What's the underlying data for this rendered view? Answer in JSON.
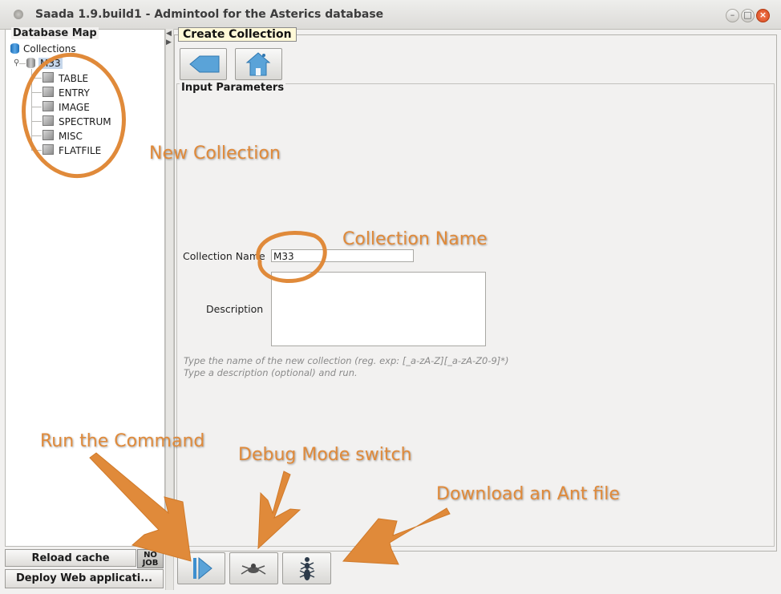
{
  "window": {
    "title": "Saada 1.9.build1 - Admintool for the Asterics database",
    "icon": "app-icon",
    "controls": {
      "minimize": "–",
      "maximize": "□",
      "close": "×"
    }
  },
  "sidebar": {
    "title": "Database Map",
    "root_label": "Collections",
    "collection": "M33",
    "categories": [
      "TABLE",
      "ENTRY",
      "IMAGE",
      "SPECTRUM",
      "MISC",
      "FLATFILE"
    ],
    "reload_label": "Reload cache",
    "job_badge": {
      "line1": "NO",
      "line2": "JOB"
    },
    "deploy_label": "Deploy Web applicati..."
  },
  "main": {
    "panel_title": "Create Collection",
    "toolbar": {
      "back_icon": "back-arrow-icon",
      "home_icon": "home-icon"
    },
    "section_title": "Input Parameters",
    "form": {
      "name_label": "Collection Name",
      "name_value": "M33",
      "description_label": "Description",
      "description_value": ""
    },
    "hints": [
      "Type the name of the new collection (reg. exp: [_a-zA-Z][_a-zA-Z0-9]*)",
      "Type a description (optional) and run."
    ],
    "bottom_toolbar": {
      "run_icon": "run-icon",
      "debug_icon": "debug-icon",
      "ant_icon": "ant-icon"
    }
  },
  "annotations": {
    "new_collection": "New Collection",
    "collection_name": "Collection Name",
    "run_command": "Run the Command",
    "debug_switch": "Debug Mode switch",
    "ant_file": "Download an Ant file",
    "color": "#e08a3a"
  }
}
